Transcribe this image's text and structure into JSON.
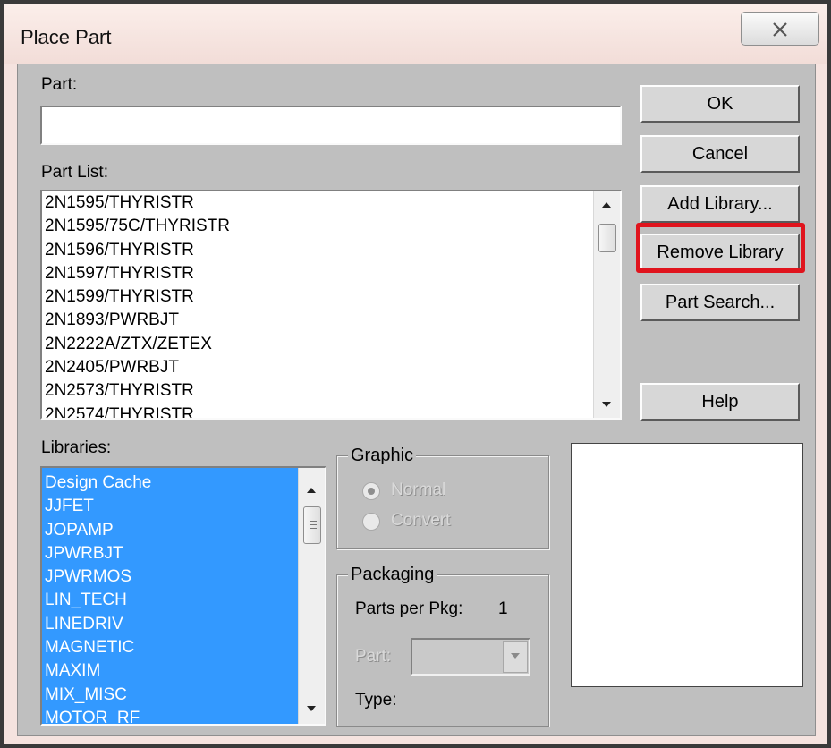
{
  "window": {
    "title": "Place Part",
    "close_icon": "close-x-icon"
  },
  "part": {
    "label": "Part:",
    "value": ""
  },
  "part_list": {
    "label": "Part List:",
    "items": [
      "2N1595/THYRISTR",
      "2N1595/75C/THYRISTR",
      "2N1596/THYRISTR",
      "2N1597/THYRISTR",
      "2N1599/THYRISTR",
      "2N1893/PWRBJT",
      "2N2222A/ZTX/ZETEX",
      "2N2405/PWRBJT",
      "2N2573/THYRISTR",
      "2N2574/THYRISTR"
    ]
  },
  "libraries": {
    "label": "Libraries:",
    "selection_color": "#3399ff",
    "items": [
      "Design Cache",
      "JJFET",
      "JOPAMP",
      "JPWRBJT",
      "JPWRMOS",
      "LIN_TECH",
      "LINEDRIV",
      "MAGNETIC",
      "MAXIM",
      "MIX_MISC",
      "MOTOR_RF"
    ]
  },
  "graphic": {
    "legend": "Graphic",
    "normal_label": "Normal",
    "convert_label": "Convert",
    "selected": "Normal"
  },
  "packaging": {
    "legend": "Packaging",
    "parts_per_pkg_label": "Parts per Pkg:",
    "parts_per_pkg_value": "1",
    "part_label": "Part:",
    "part_value": "",
    "type_label": "Type:"
  },
  "buttons": {
    "ok": "OK",
    "cancel": "Cancel",
    "add_library": "Add Library...",
    "remove_library": "Remove Library",
    "part_search": "Part Search...",
    "help": "Help"
  },
  "highlight": {
    "target": "remove_library",
    "color": "#e0141d"
  }
}
